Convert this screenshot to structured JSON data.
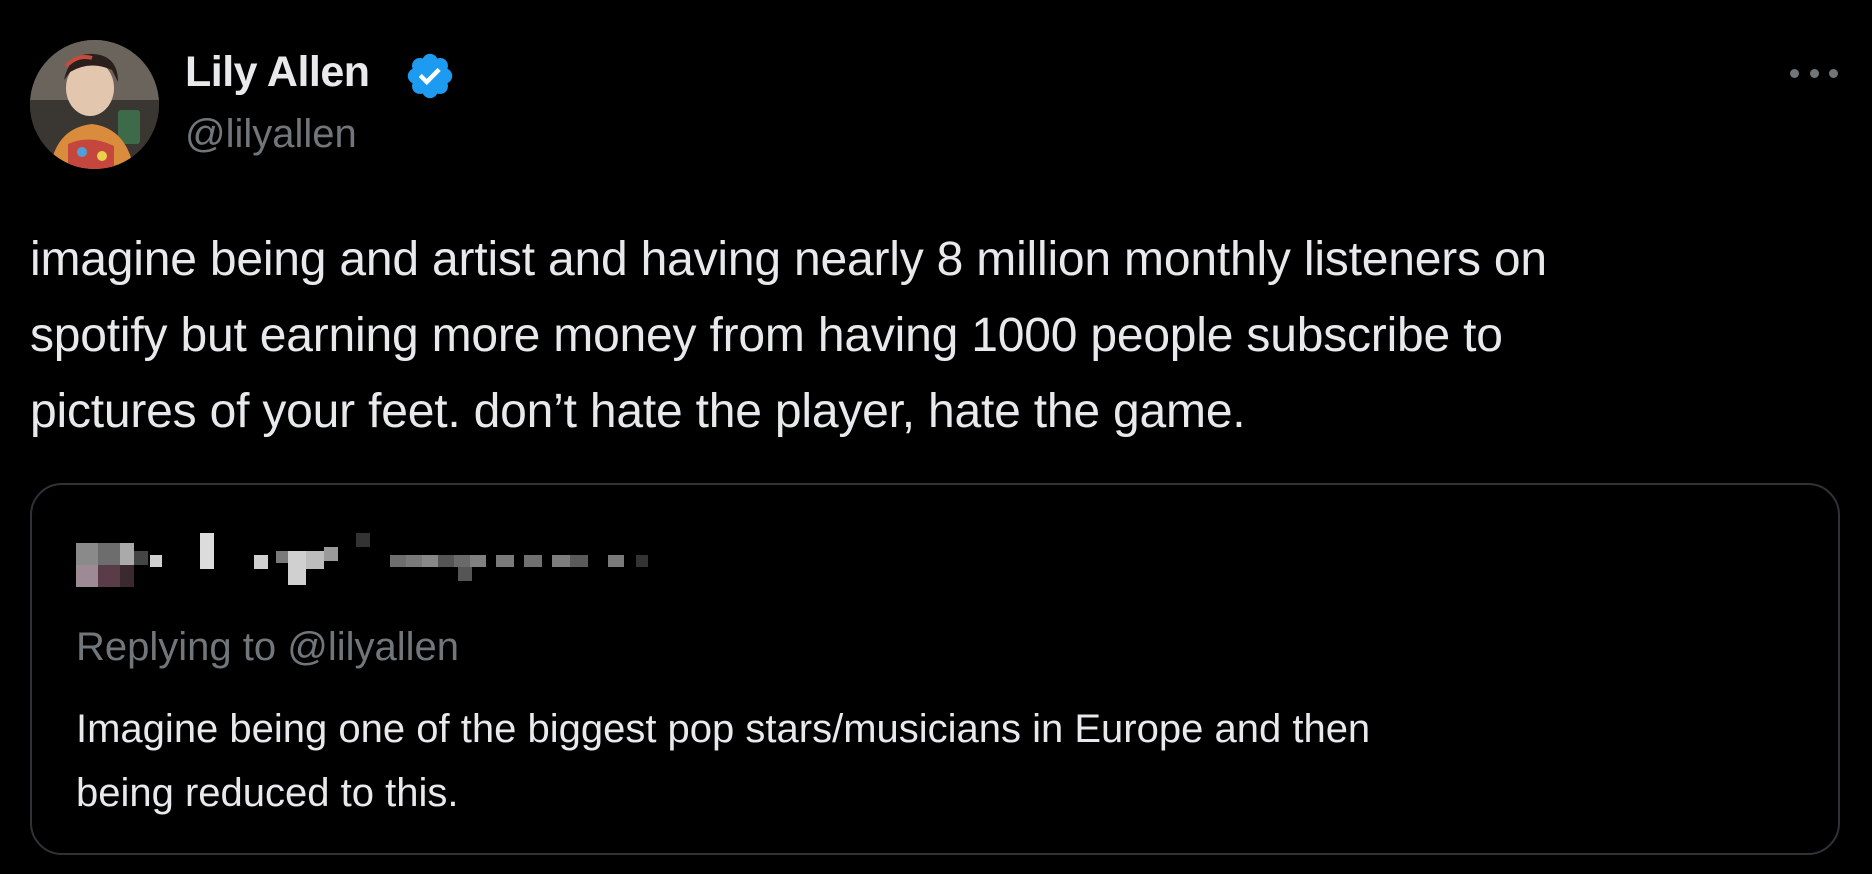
{
  "tweet": {
    "author": {
      "name": "Lily Allen",
      "handle": "@lilyallen",
      "verified": true,
      "verified_icon": "verified-badge-icon"
    },
    "more_icon": "more-horizontal-icon",
    "text": "imagine being and artist and having nearly 8 million monthly listeners on\nspotify but earning more money from having 1000 people subscribe to\npictures of your feet. don’t hate the player, hate the game.",
    "quote": {
      "replying_to": "Replying to @lilyallen",
      "text": "Imagine being one of the biggest pop stars/musicians in Europe and then\nbeing reduced to this."
    }
  },
  "colors": {
    "background": "#000000",
    "text": "#e7e9ea",
    "secondary_text": "#71767b",
    "border": "#2f3336",
    "verified": "#1d9bf0"
  }
}
